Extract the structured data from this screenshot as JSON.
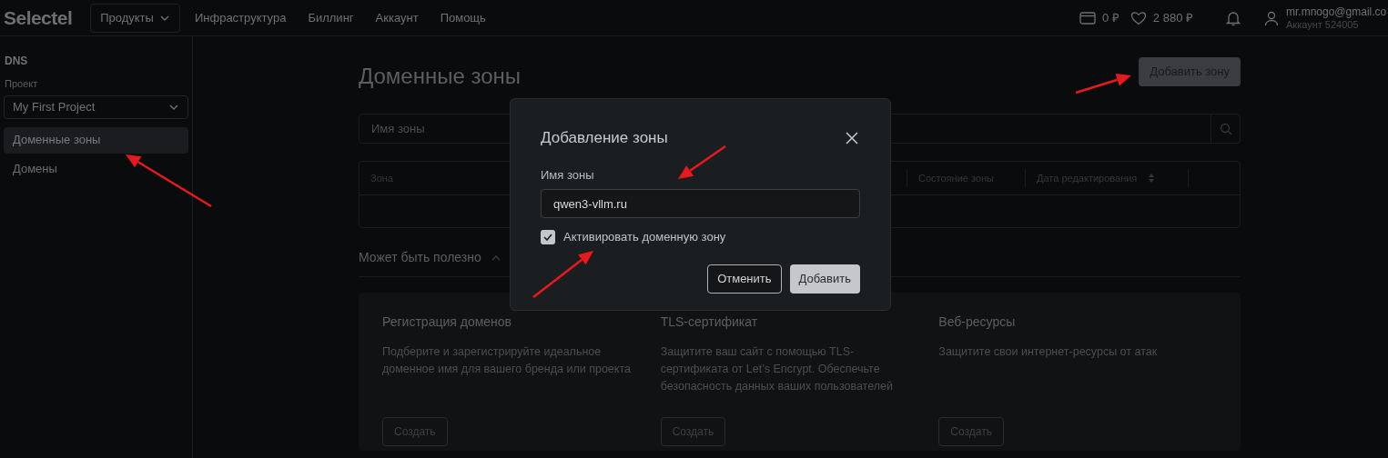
{
  "header": {
    "logo": "Selectel",
    "nav": [
      {
        "label": "Продукты",
        "kind": "dropdown"
      },
      {
        "label": "Инфраструктура",
        "kind": "link"
      },
      {
        "label": "Биллинг",
        "kind": "link"
      },
      {
        "label": "Аккаунт",
        "kind": "link"
      },
      {
        "label": "Помощь",
        "kind": "link"
      }
    ],
    "balance": "0 ₽",
    "bonus": "2 880 ₽",
    "user": {
      "email": "mr.mnogo@gmail.co",
      "account": "Аккаунт 524005"
    }
  },
  "sidebar": {
    "section": "DNS",
    "project_label": "Проект",
    "project": "My First Project",
    "items": [
      {
        "label": "Доменные зоны",
        "selected": true
      },
      {
        "label": "Домены",
        "selected": false
      }
    ]
  },
  "main": {
    "title": "Доменные зоны",
    "add_button": "Добавить зону",
    "search": {
      "placeholder": "Имя зоны"
    },
    "table": {
      "columns": [
        {
          "label": "Зона",
          "sortable": false
        },
        {
          "label": "Состояние зоны",
          "sortable": false
        },
        {
          "label": "Дата редактирования",
          "sortable": true
        }
      ]
    },
    "useful": {
      "title": "Может быть полезно",
      "expanded": true,
      "cards": [
        {
          "title": "Регистрация доменов",
          "text": "Подберите и зарегистрируйте идеальное доменное имя для вашего бренда или проекта",
          "button": "Создать"
        },
        {
          "title": "TLS-сертификат",
          "text": "Защитите ваш сайт с помощью TLS-сертификата от Let’s Encrypt. Обеспечьте безопасность данных ваших пользователей",
          "button": "Создать"
        },
        {
          "title": "Веб-ресурсы",
          "text": "Защитите свои интернет-ресурсы от атак",
          "button": "Создать"
        }
      ]
    }
  },
  "dialog": {
    "title": "Добавление зоны",
    "field_label": "Имя зоны",
    "field_value": "qwen3-vllm.ru",
    "checkbox": {
      "label": "Активировать доменную зону",
      "checked": true
    },
    "buttons": [
      {
        "label": "Отменить",
        "kind": "secondary"
      },
      {
        "label": "Добавить",
        "kind": "primary"
      }
    ]
  }
}
